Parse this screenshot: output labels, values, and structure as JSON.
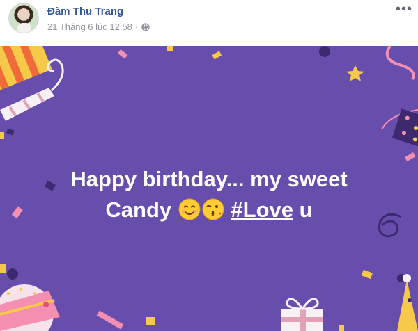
{
  "post": {
    "author": "Đàm Thu Trang",
    "timestamp": "21 Tháng 6 lúc 12:58",
    "separator": "·",
    "privacy_icon": "globe-icon",
    "more_label": "•••"
  },
  "card": {
    "background_color": "#674ead",
    "line1": "Happy birthday... my sweet",
    "line2_start": "Candy",
    "emojis": [
      "smiling-face-icon",
      "face-blowing-kiss-icon"
    ],
    "hashtag": "#Love",
    "line2_end": "u"
  }
}
